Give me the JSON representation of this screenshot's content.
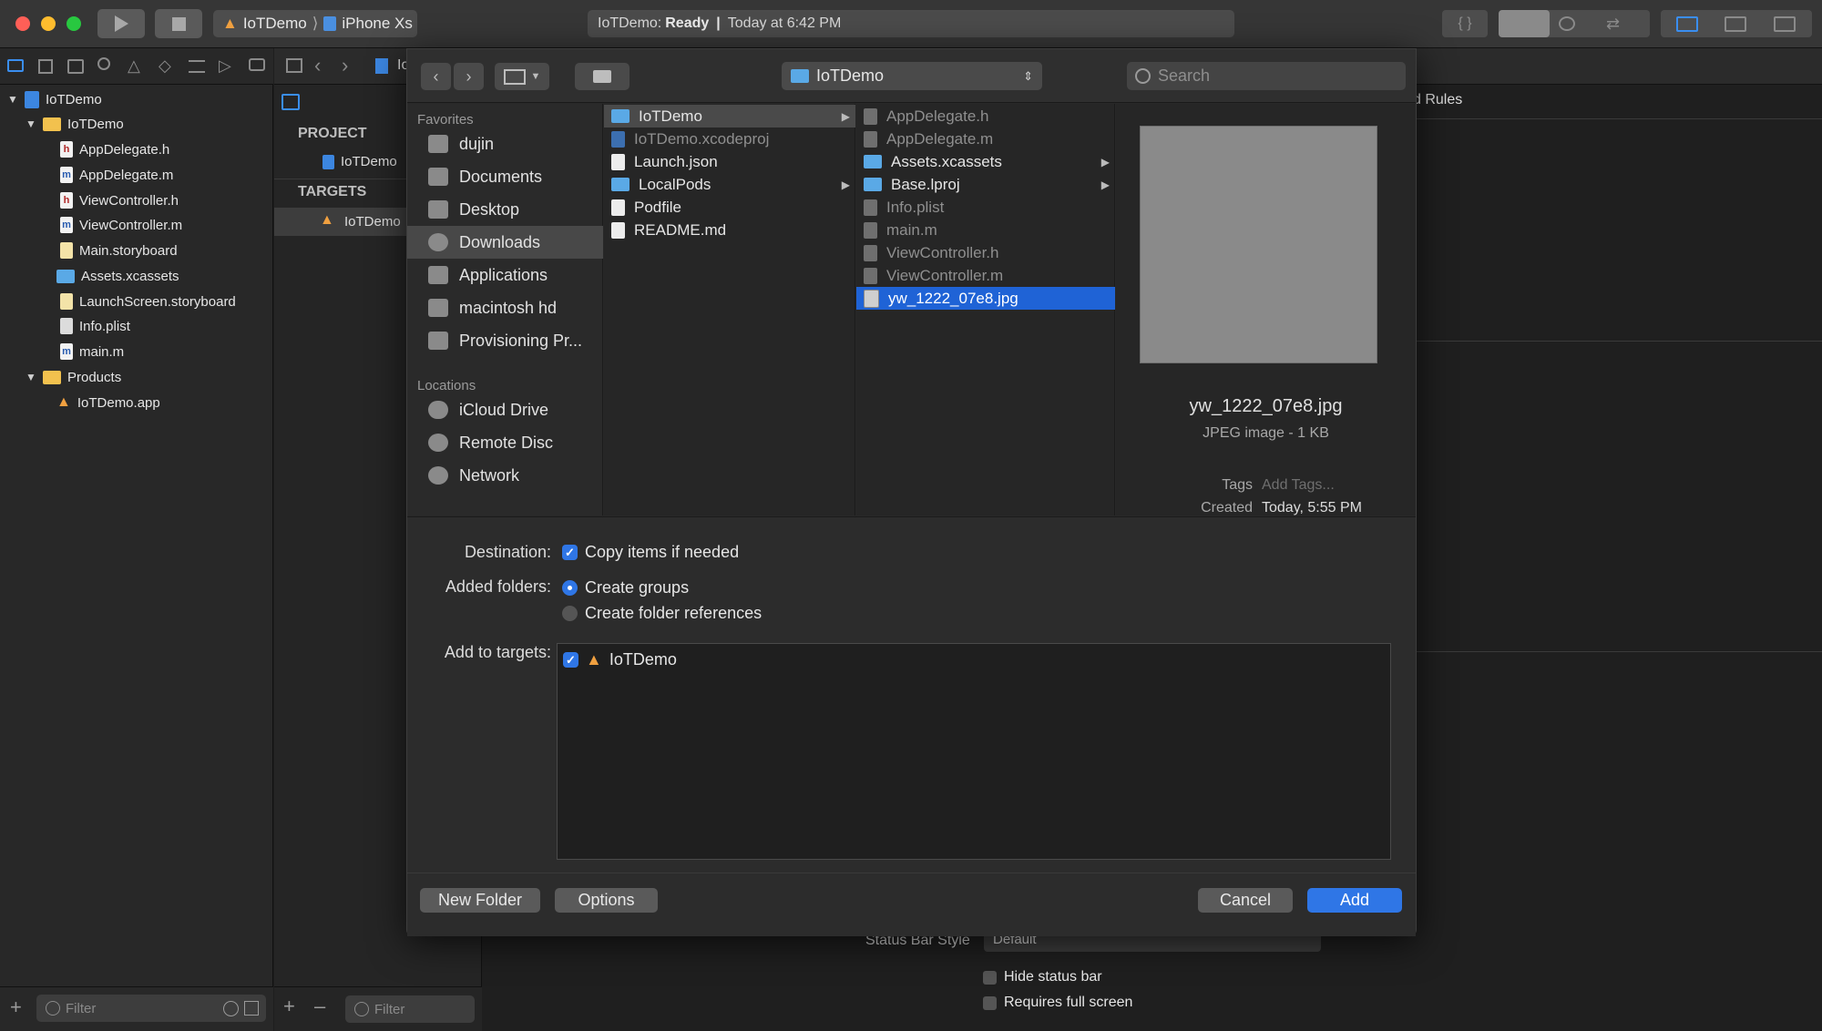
{
  "toolbar": {
    "scheme_app": "IoTDemo",
    "scheme_device": "iPhone Xs",
    "status_app": "IoTDemo:",
    "status_state": "Ready",
    "status_sep": "|",
    "status_time": "Today at 6:42 PM"
  },
  "navigator": {
    "items": [
      {
        "label": "IoTDemo",
        "kind": "project"
      },
      {
        "label": "IoTDemo",
        "kind": "folder"
      },
      {
        "label": "AppDelegate.h",
        "kind": "h"
      },
      {
        "label": "AppDelegate.m",
        "kind": "m"
      },
      {
        "label": "ViewController.h",
        "kind": "h"
      },
      {
        "label": "ViewController.m",
        "kind": "m"
      },
      {
        "label": "Main.storyboard",
        "kind": "storyboard"
      },
      {
        "label": "Assets.xcassets",
        "kind": "assets"
      },
      {
        "label": "LaunchScreen.storyboard",
        "kind": "storyboard"
      },
      {
        "label": "Info.plist",
        "kind": "plist"
      },
      {
        "label": "main.m",
        "kind": "m"
      },
      {
        "label": "Products",
        "kind": "folder"
      },
      {
        "label": "IoTDemo.app",
        "kind": "app"
      }
    ],
    "filter_placeholder": "Filter"
  },
  "editor": {
    "project_header": "PROJECT",
    "project_item": "IoTDemo",
    "targets_header": "TARGETS",
    "target_item": "IoTDemo",
    "tab_partial": "d Rules",
    "breadcrumb_partial": "Io",
    "status_bar_style_label": "Status Bar Style",
    "status_bar_style_value": "Default",
    "hide_status_bar": "Hide status bar",
    "requires_full_screen": "Requires full screen",
    "filter_placeholder": "Filter"
  },
  "dialog": {
    "location_popup": "IoTDemo",
    "search_placeholder": "Search",
    "favorites_header": "Favorites",
    "favorites": [
      "dujin",
      "Documents",
      "Desktop",
      "Downloads",
      "Applications",
      "macintosh hd",
      "Provisioning Pr..."
    ],
    "locations_header": "Locations",
    "locations": [
      "iCloud Drive",
      "Remote Disc",
      "Network"
    ],
    "column1": [
      {
        "name": "IoTDemo",
        "type": "folder",
        "arrow": true
      },
      {
        "name": "IoTDemo.xcodeproj",
        "type": "proj",
        "dim": true
      },
      {
        "name": "Launch.json",
        "type": "file"
      },
      {
        "name": "LocalPods",
        "type": "folder",
        "arrow": true
      },
      {
        "name": "Podfile",
        "type": "file"
      },
      {
        "name": "README.md",
        "type": "file"
      }
    ],
    "column2": [
      {
        "name": "AppDelegate.h",
        "type": "h",
        "dim": true
      },
      {
        "name": "AppDelegate.m",
        "type": "m",
        "dim": true
      },
      {
        "name": "Assets.xcassets",
        "type": "folder",
        "arrow": true
      },
      {
        "name": "Base.lproj",
        "type": "folder",
        "arrow": true
      },
      {
        "name": "Info.plist",
        "type": "file",
        "dim": true
      },
      {
        "name": "main.m",
        "type": "m",
        "dim": true
      },
      {
        "name": "ViewController.h",
        "type": "h",
        "dim": true
      },
      {
        "name": "ViewController.m",
        "type": "m",
        "dim": true
      },
      {
        "name": "yw_1222_07e8.jpg",
        "type": "jpg",
        "selected": true
      }
    ],
    "preview": {
      "filename": "yw_1222_07e8.jpg",
      "kind": "JPEG image - 1 KB",
      "tags_label": "Tags",
      "tags_placeholder": "Add Tags...",
      "created_label": "Created",
      "created_value": "Today, 5:55 PM"
    },
    "options": {
      "destination_label": "Destination:",
      "copy_items": "Copy items if needed",
      "added_folders_label": "Added folders:",
      "create_groups": "Create groups",
      "create_folder_refs": "Create folder references",
      "add_to_targets_label": "Add to targets:",
      "target_name": "IoTDemo"
    },
    "buttons": {
      "new_folder": "New Folder",
      "options": "Options",
      "cancel": "Cancel",
      "add": "Add"
    }
  },
  "colors": {
    "accent": "#2f76e6",
    "selection": "#1f63d6",
    "folder_blue": "#5aa9e6"
  }
}
